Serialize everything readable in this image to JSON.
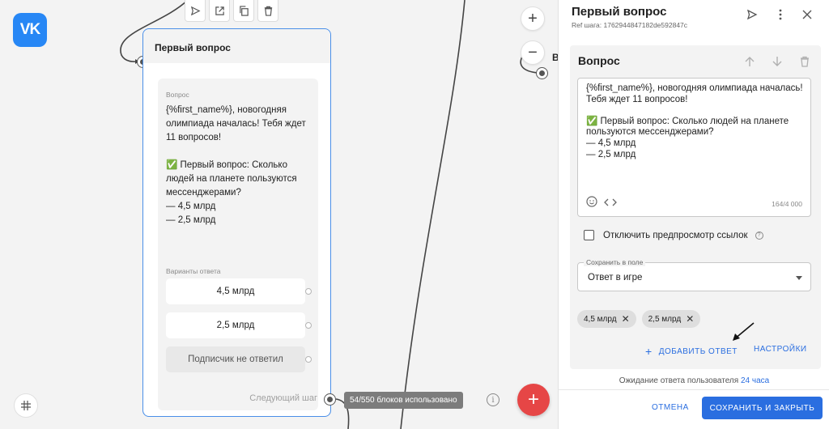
{
  "brand": {
    "logo_text": "VK",
    "color": "#2787f5"
  },
  "canvas": {
    "node": {
      "title": "Первый вопрос",
      "message_label": "Вопрос",
      "message_text": "{%first_name%}, новогодняя олимпиада началась! Тебя ждет 11 вопросов!\n\n✅ Первый вопрос: Сколько людей на планете пользуются мессенджерами?\n— 4,5 млрд\n— 2,5 млрд",
      "options_label": "Варианты ответа",
      "options": [
        "4,5 млрд",
        "2,5 млрд",
        "Подписчик не ответил"
      ],
      "next_step": "Следующий шаг"
    },
    "toolbar_icons": [
      "send-icon",
      "open-external-icon",
      "copy-icon",
      "trash-icon"
    ],
    "peek_node_letter": "В",
    "zoom_in": "+",
    "zoom_out": "−",
    "blocks_badge": "54/550 блоков использовано",
    "info_glyph": "i",
    "fab_glyph": "+",
    "accent_red": "#e64646",
    "accent_blue": "#4a8fe8"
  },
  "panel": {
    "title": "Первый вопрос",
    "ref": "Ref шага: 1762944847182de592847c",
    "section_title": "Вопрос",
    "editor_text": "{%first_name%}, новогодняя олимпиада началась! Тебя ждет 11 вопросов!\n\n✅ Первый вопрос: Сколько людей на планете пользуются мессенджерами?\n— 4,5 млрд\n— 2,5 млрд",
    "counter": "164/4 000",
    "disable_preview_label": "Отключить предпросмотр ссылок",
    "help_glyph": "?",
    "save_field_legend": "Сохранить в поле",
    "save_field_value": "Ответ в игре",
    "chips": [
      "4,5 млрд",
      "2,5 млрд"
    ],
    "chip_remove_glyph": "✕",
    "add_answer": "ДОБАВИТЬ ОТВЕТ",
    "add_glyph": "+",
    "settings": "НАСТРОЙКИ",
    "wait_text": "Ожидание ответа пользователя",
    "wait_link": "24 часа",
    "cancel": "ОТМЕНА",
    "save_close": "СОХРАНИТЬ И ЗАКРЫТЬ",
    "link_color": "#2a6ee0"
  }
}
